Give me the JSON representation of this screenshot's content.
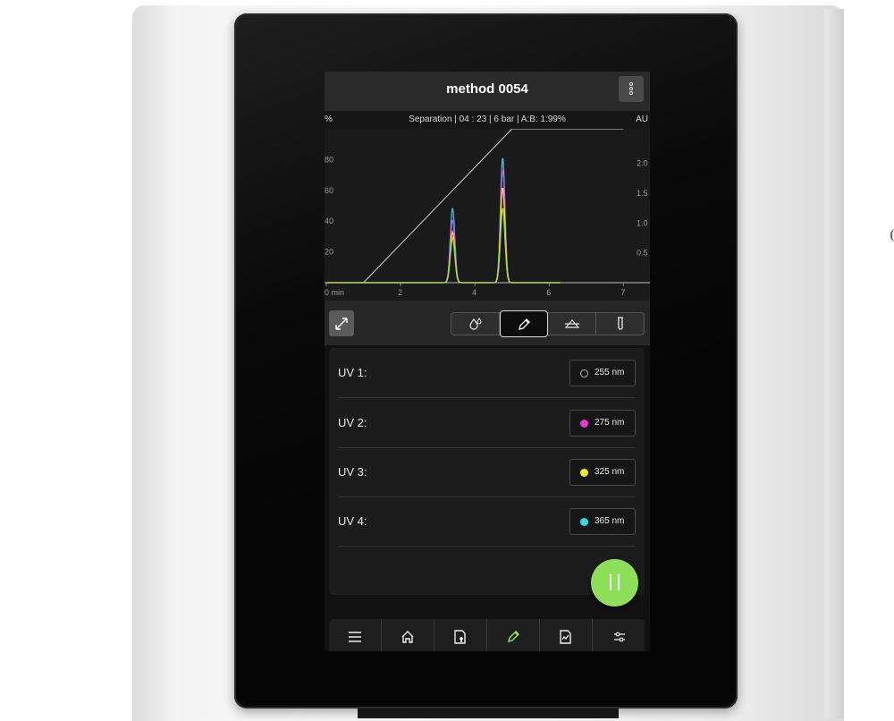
{
  "screen": {
    "title": "method 0054",
    "status": {
      "left_unit": "%",
      "right_unit": "AU",
      "text": "Separation | 04 : 23 | 6 bar | A:B: 1:99%"
    }
  },
  "chart_data": {
    "type": "line",
    "xlabel": "min",
    "x_ticks": [
      "0 min",
      "2",
      "4",
      "6",
      "7"
    ],
    "y_left_ticks": [
      "80",
      "60",
      "40",
      "20"
    ],
    "y_right_ticks": [
      "2.0",
      "1.5",
      "1.0",
      "0.5"
    ],
    "xlim": [
      0,
      8
    ],
    "ylim_left": [
      0,
      100
    ],
    "ylim_right": [
      0,
      2.5
    ],
    "gradient": {
      "x": [
        1,
        5,
        8
      ],
      "y": [
        0,
        100,
        100
      ]
    },
    "series": [
      {
        "color": "#3fc0f0",
        "peaks": [
          {
            "x": 3.4,
            "height": 1.25
          },
          {
            "x": 4.75,
            "height": 2.1
          }
        ]
      },
      {
        "color": "#e040e0",
        "peaks": [
          {
            "x": 3.4,
            "height": 1.05
          },
          {
            "x": 4.75,
            "height": 1.9
          }
        ]
      },
      {
        "color": "#f2e52a",
        "peaks": [
          {
            "x": 3.4,
            "height": 0.85
          },
          {
            "x": 4.75,
            "height": 1.6
          }
        ]
      },
      {
        "color": "#9ad84a",
        "peaks": [
          {
            "x": 3.4,
            "height": 0.75
          },
          {
            "x": 4.75,
            "height": 1.25
          }
        ]
      }
    ]
  },
  "toolbar": {
    "expand_icon": "expand-icon",
    "tabs": [
      {
        "icon": "droplets-icon",
        "glyph": "💧"
      },
      {
        "icon": "pencil-icon",
        "glyph": "✎",
        "active": true
      },
      {
        "icon": "gradient-icon",
        "glyph": "⏶"
      },
      {
        "icon": "test-tube-icon",
        "glyph": "🧪"
      }
    ]
  },
  "uv_channels": [
    {
      "label": "UV 1:",
      "value": "255 nm",
      "color": "#000000"
    },
    {
      "label": "UV 2:",
      "value": "275 nm",
      "color": "#e83ad0"
    },
    {
      "label": "UV 3:",
      "value": "325 nm",
      "color": "#f2ec20"
    },
    {
      "label": "UV 4:",
      "value": "365 nm",
      "color": "#30d8e8"
    }
  ],
  "fab": {
    "icon": "pause-icon",
    "color": "#8ee05a"
  },
  "nav": [
    {
      "icon": "menu-icon"
    },
    {
      "icon": "home-icon"
    },
    {
      "icon": "method-document-icon"
    },
    {
      "icon": "pencil-icon",
      "active": true,
      "active_color": "#8ee05a"
    },
    {
      "icon": "report-chart-icon"
    },
    {
      "icon": "settings-sliders-icon"
    }
  ]
}
